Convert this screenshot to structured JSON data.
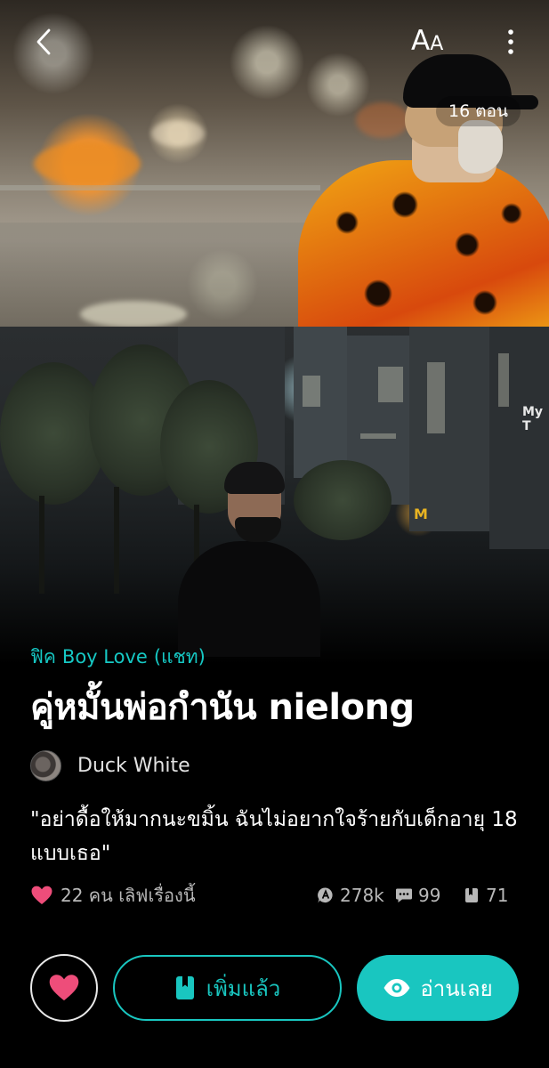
{
  "header": {
    "back_icon": "chevron-left-icon",
    "font_size_label_big": "A",
    "font_size_label_small": "A",
    "more_icon": "vertical-dots-icon",
    "episode_count": "16 ตอน"
  },
  "cover": {
    "sign_text": "My T",
    "logo_text": "M"
  },
  "story": {
    "category_genre": "ฟิค",
    "category_tag": "Boy Love",
    "category_type": "(แชท)",
    "title": "คู่หมั้นพ่อกำนัน nielong",
    "author": "Duck White",
    "synopsis": "\"อย่าดื้อให้มากนะขมิ้น ฉันไม่อยากใจร้ายกับเด็กอายุ 18 แบบเธอ\""
  },
  "stats": {
    "likes_text": "22 คน เลิฟเรื่องนี้",
    "views": "278k",
    "comments": "99",
    "chapters": "71"
  },
  "actions": {
    "added_label": "เพิ่มแล้ว",
    "read_label": "อ่านเลย"
  },
  "colors": {
    "accent": "#19c6c0",
    "heart": "#ee4d7a",
    "background": "#000000"
  }
}
